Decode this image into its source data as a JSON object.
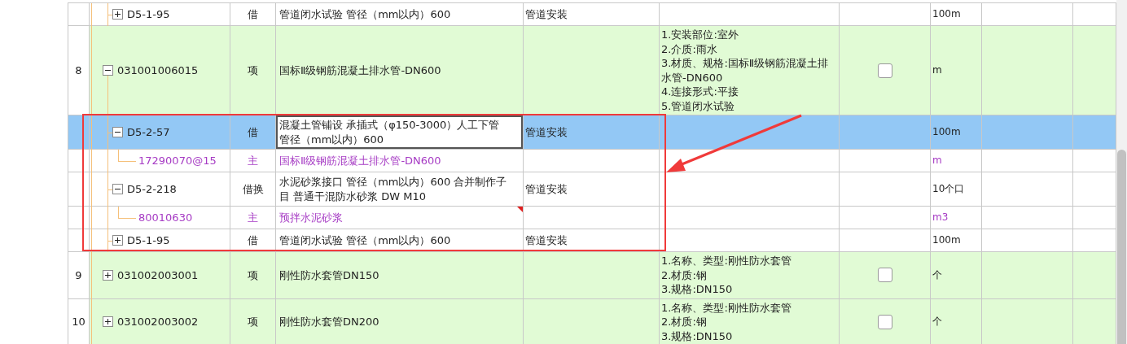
{
  "rows": [
    {
      "children": [
        {
          "code": "D5-1-95",
          "kind": "quota",
          "expanded": false,
          "selected": false,
          "flagged": false,
          "type": "借",
          "name": "管道闭水试验 管径（mm以内）600",
          "specialty": "管道安装",
          "unit": "100m"
        }
      ]
    },
    {
      "number": "8",
      "code": "031001006015",
      "kind": "item",
      "expanded": true,
      "selected": false,
      "flagged": false,
      "type": "项",
      "name": "国标Ⅱ级钢筋混凝土排水管-DN600",
      "features": [
        "1.安装部位:室外",
        "2.介质:雨水",
        "3.材质、规格:国标Ⅱ级钢筋混凝土排水管-DN600",
        "4.连接形式:平接",
        "5.管道闭水试验"
      ],
      "checked": false,
      "unit": "m",
      "children": [
        {
          "code": "D5-2-57",
          "kind": "quota",
          "expanded": true,
          "selected": true,
          "flagged": false,
          "type": "借",
          "name": "混凝土管铺设 承插式（φ150-3000）人工下管管径（mm以内）600",
          "specialty": "管道安装",
          "unit": "100m",
          "children": [
            {
              "code": "17290070@15",
              "kind": "material",
              "selected": false,
              "flagged": false,
              "type": "主",
              "name": "国标Ⅱ级钢筋混凝土排水管-DN600",
              "unit": "m"
            }
          ]
        },
        {
          "code": "D5-2-218",
          "kind": "quota",
          "expanded": true,
          "selected": false,
          "flagged": false,
          "type": "借换",
          "name": "水泥砂浆接口 管径（mm以内）600  合并制作子目 普通干混防水砂浆 DW M10",
          "specialty": "管道安装",
          "unit": "10个口",
          "children": [
            {
              "code": "80010630",
              "kind": "material",
              "selected": false,
              "flagged": true,
              "type": "主",
              "name": "预拌水泥砂浆",
              "unit": "m3"
            }
          ]
        },
        {
          "code": "D5-1-95",
          "kind": "quota",
          "expanded": false,
          "selected": false,
          "flagged": false,
          "type": "借",
          "name": "管道闭水试验 管径（mm以内）600",
          "specialty": "管道安装",
          "unit": "100m"
        }
      ]
    },
    {
      "number": "9",
      "code": "031002003001",
      "kind": "item",
      "expanded": false,
      "selected": false,
      "flagged": false,
      "type": "项",
      "name": "刚性防水套管DN150",
      "features": [
        "1.名称、类型:刚性防水套管",
        "2.材质:钢",
        "3.规格:DN150"
      ],
      "checked": false,
      "unit": "个"
    },
    {
      "number": "10",
      "code": "031002003002",
      "kind": "item",
      "expanded": false,
      "selected": false,
      "flagged": false,
      "type": "项",
      "name": "刚性防水套管DN200",
      "features": [
        "1.名称、类型:刚性防水套管",
        "2.材质:钢",
        "3.规格:DN150"
      ],
      "checked": false,
      "unit": "个"
    }
  ]
}
